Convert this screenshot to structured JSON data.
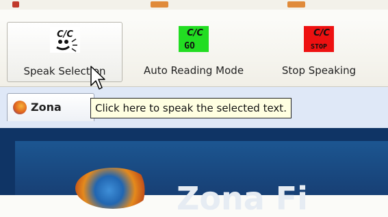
{
  "colors": {
    "tab_strip": "#dfe8f7",
    "content_bg": "#0f3465",
    "go_icon_bg": "#22dd22",
    "stop_icon_bg": "#ee1111",
    "tooltip_bg": "#ffffe1"
  },
  "toolbar": {
    "buttons": [
      {
        "label": "Speak Selection",
        "icon": "speak-selection-icon",
        "icon_text": "C/C"
      },
      {
        "label": "Auto Reading Mode",
        "icon": "auto-reading-go-icon",
        "icon_text": "C/C",
        "icon_badge": "GO"
      },
      {
        "label": "Stop Speaking",
        "icon": "stop-speaking-icon",
        "icon_text": "C/C",
        "icon_badge": "STOP"
      }
    ]
  },
  "tab": {
    "title": "Zona",
    "icon": "firefox-icon"
  },
  "tooltip": {
    "text": "Click here to speak the selected text."
  },
  "content": {
    "big_text": "Zona Fi"
  }
}
